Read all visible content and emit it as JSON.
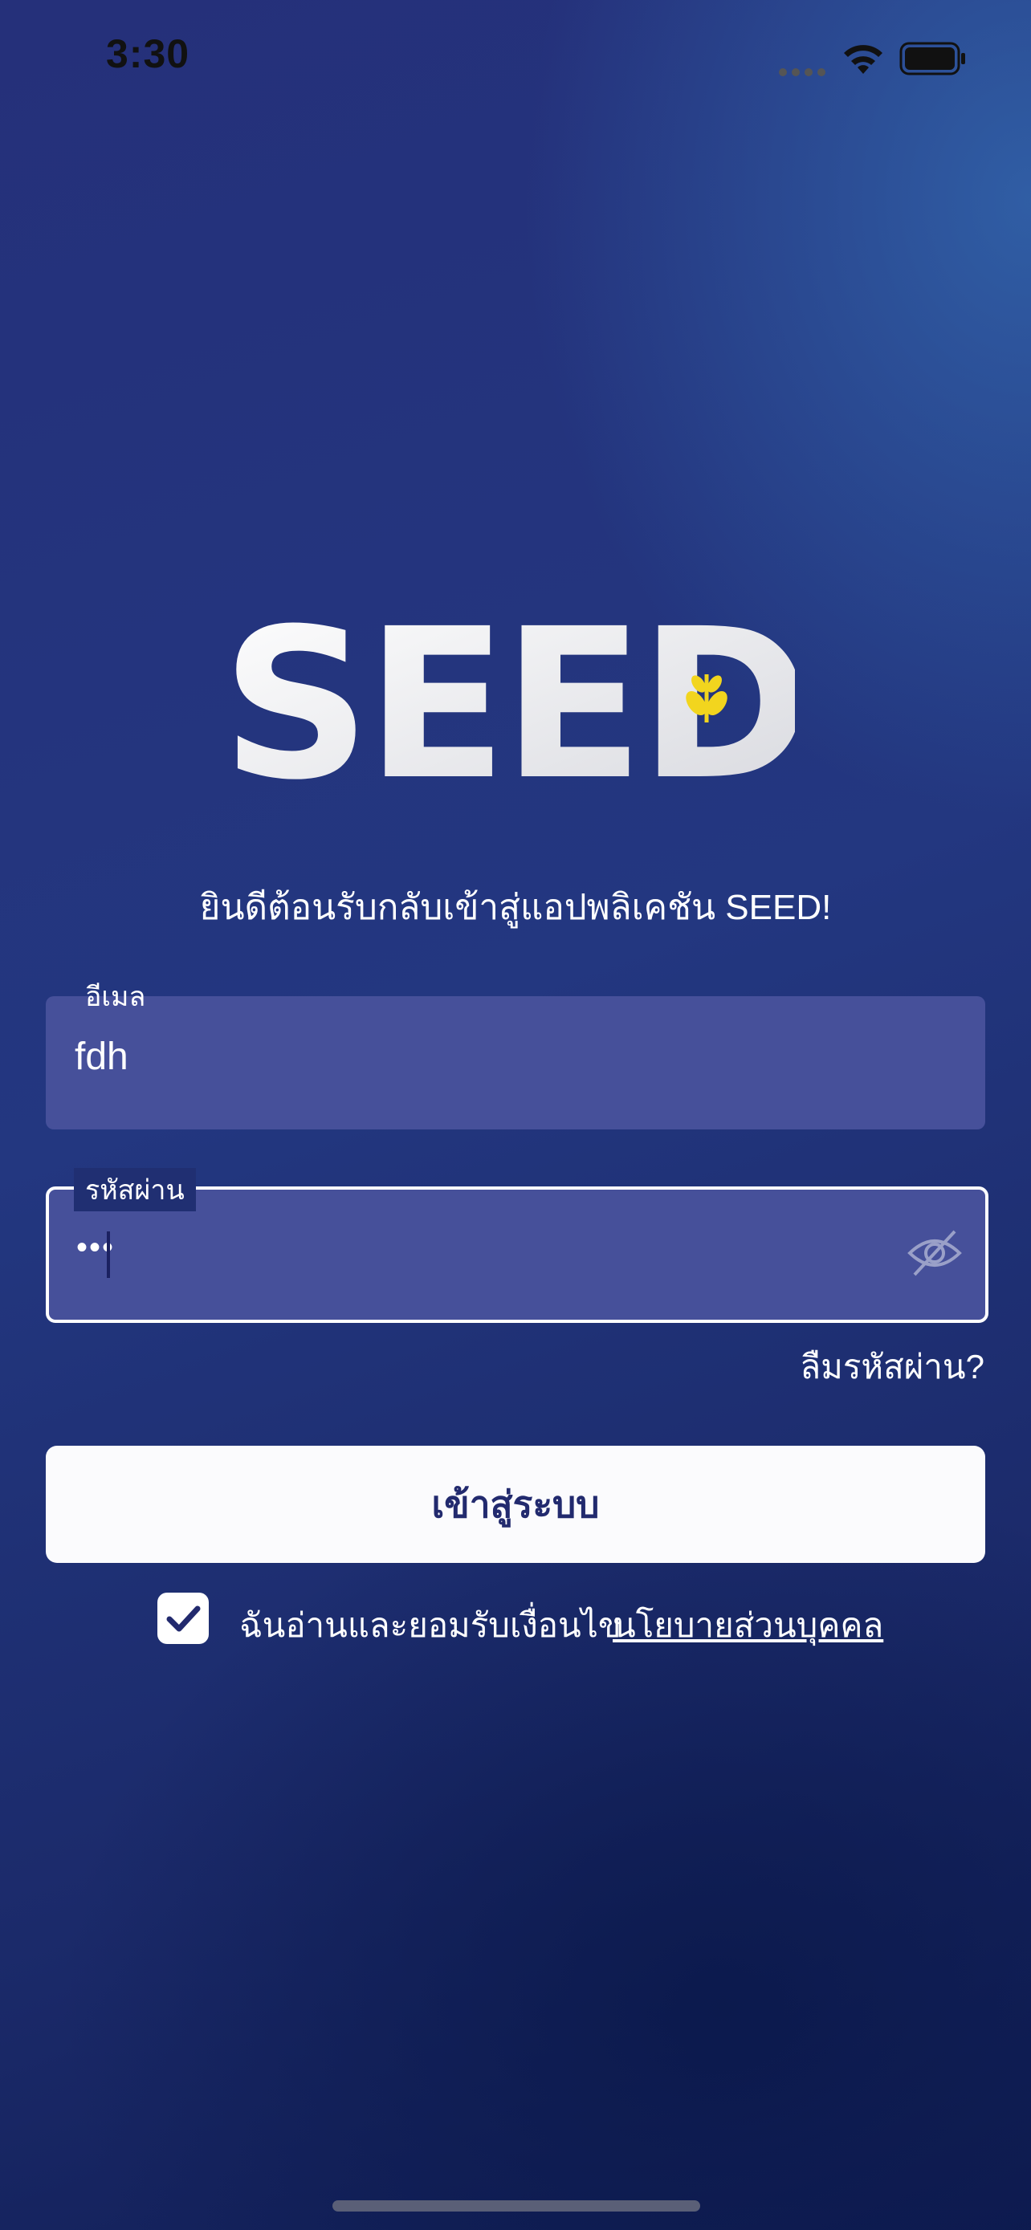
{
  "status_bar": {
    "time": "3:30"
  },
  "brand": {
    "logo_text": "SEED",
    "leaf_color": "#f2d51e"
  },
  "welcome_text": "ยินดีต้อนรับกลับเข้าสู่แอปพลิเคชัน SEED!",
  "email": {
    "label": "อีเมล",
    "value": "fdh"
  },
  "password": {
    "label": "รหัสผ่าน",
    "masked_value": "•••"
  },
  "forgot_password": "ลืมรหัสผ่าน?",
  "login_button": "เข้าสู่ระบบ",
  "consent": {
    "checked": true,
    "text": "ฉันอ่านและยอมรับเงื่อนไข",
    "link": "นโยบายส่วนบุคคล"
  },
  "colors": {
    "field_bg": "#46509a",
    "button_text": "#222a6e"
  }
}
